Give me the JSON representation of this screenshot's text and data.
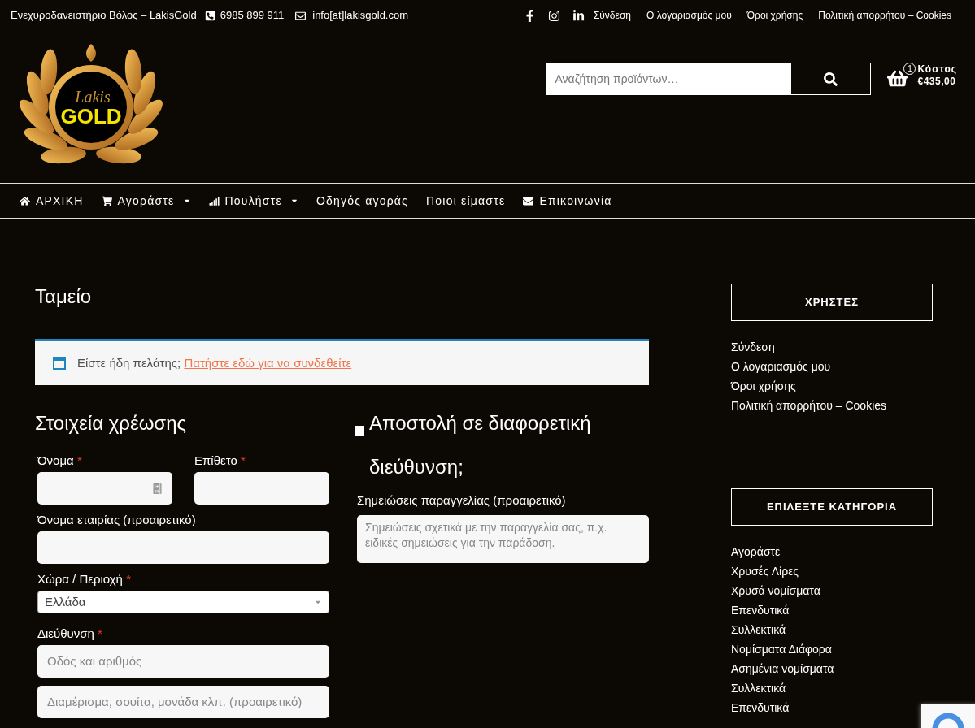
{
  "topbar": {
    "site_name": "Ενεχυροδανειστήριο Βόλος – LakisGold",
    "phone": "6985 899 911",
    "email": "info[at]lakisgold.com",
    "social": [
      {
        "kind": "facebook"
      },
      {
        "kind": "instagram"
      },
      {
        "kind": "linkedin"
      }
    ],
    "links": [
      "Σύνδεση",
      "Ο λογαριασμός μου",
      "Όροι χρήσης",
      "Πολιτική απορρήτου – Cookies"
    ]
  },
  "logo": {
    "script": "Lakis",
    "word": "GOLD"
  },
  "search": {
    "placeholder": "Αναζήτηση προϊόντων…"
  },
  "cart": {
    "count": "1",
    "label": "Κόστος",
    "total": "€435,00"
  },
  "nav": [
    {
      "label": "ΑΡΧΙΚΗ",
      "kind": "home",
      "dropdown": false
    },
    {
      "label": "Αγοράστε",
      "kind": "shop",
      "dropdown": true
    },
    {
      "label": "Πουλήστε",
      "kind": "sell",
      "dropdown": true
    },
    {
      "label": "Οδηγός αγοράς",
      "kind": "plain",
      "dropdown": false
    },
    {
      "label": "Ποιοι είμαστε",
      "kind": "plain",
      "dropdown": false
    },
    {
      "label": "Επικοινωνία",
      "kind": "contact",
      "dropdown": false
    }
  ],
  "page_title": "Ταμείο",
  "notice": {
    "text": "Είστε ήδη πελάτης;",
    "link": "Πατήστε εδώ για να συνδεθείτε"
  },
  "billing": {
    "title": "Στοιχεία χρέωσης",
    "rows": [
      [
        {
          "kind": "text",
          "label": "Όνομα",
          "mark": "*",
          "autofill_icon": true
        },
        {
          "kind": "text",
          "label": "Επίθετο",
          "mark": "*",
          "autofill_icon": false
        }
      ],
      [
        {
          "kind": "text",
          "label": "Όνομα εταιρίας (προαιρετικό)",
          "autofill_icon": false
        }
      ],
      [
        {
          "kind": "select",
          "label": "Χώρα / Περιοχή",
          "mark": "*",
          "value": "Ελλάδα"
        }
      ],
      [
        {
          "kind": "text",
          "label": "Διεύθυνση",
          "mark": "*",
          "placeholder": "Οδός και αριθμός",
          "autofill_icon": false
        }
      ],
      [
        {
          "kind": "text",
          "placeholder": "Διαμέρισμα, σουίτα, μονάδα κλπ. (προαιρετικό)",
          "autofill_icon": false
        }
      ]
    ]
  },
  "shipping": {
    "checked": false,
    "label": "Αποστολή σε διαφορετική διεύθυνση;"
  },
  "notes": {
    "label": "Σημειώσεις παραγγελίας (προαιρετικό)",
    "placeholder": "Σημειώσεις σχετικά με την παραγγελία σας, π.χ. ειδικές σημειώσεις για την παράδοση."
  },
  "sidebar": [
    {
      "title": "ΧΡΗΣΤΕΣ",
      "items": [
        "Σύνδεση",
        "Ο λογαριασμός μου",
        "Όροι χρήσης",
        "Πολιτική απορρήτου – Cookies"
      ]
    },
    {
      "title": "ΕΠΙΛΕΞΤΕ ΚΑΤΗΓΟΡΙΑ",
      "items": [
        "Αγοράστε",
        "Χρυσές Λίρες",
        "Χρυσά νομίσματα",
        "Επενδυτικά",
        "Συλλεκτικά",
        "Νομίσματα Διάφορα",
        "Ασημένια νομίσματα",
        "Συλλεκτικά",
        "Επενδυτικά"
      ]
    }
  ]
}
